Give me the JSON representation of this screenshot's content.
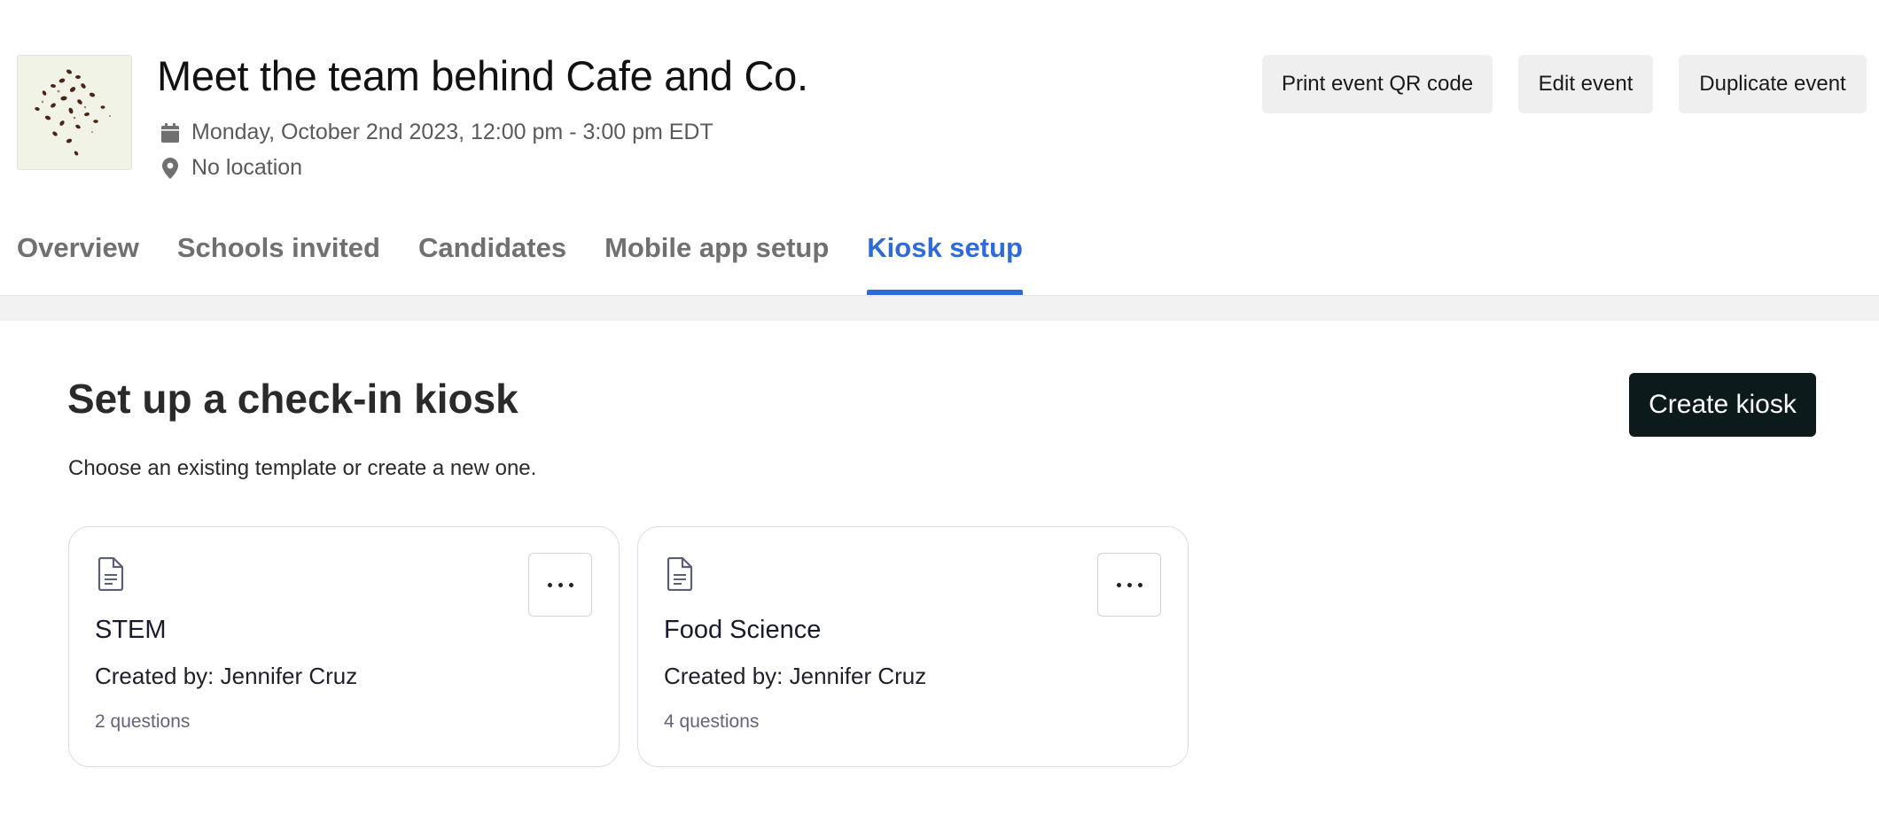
{
  "event": {
    "title": "Meet the team behind Cafe and Co.",
    "date": "Monday, October 2nd 2023, 12:00 pm - 3:00 pm EDT",
    "location": "No location",
    "date_icon": "calendar-icon",
    "location_icon": "map-pin-icon"
  },
  "header_actions": {
    "print_qr": "Print event QR code",
    "edit": "Edit event",
    "duplicate": "Duplicate event"
  },
  "tabs": [
    {
      "label": "Overview",
      "active": false
    },
    {
      "label": "Schools invited",
      "active": false
    },
    {
      "label": "Candidates",
      "active": false
    },
    {
      "label": "Mobile app setup",
      "active": false
    },
    {
      "label": "Kiosk setup",
      "active": true
    }
  ],
  "kiosk": {
    "title": "Set up a check-in kiosk",
    "subtitle": "Choose an existing template or create a new one.",
    "create_button": "Create kiosk",
    "templates": [
      {
        "name": "STEM",
        "creator": "Created by: Jennifer Cruz",
        "questions": "2 questions"
      },
      {
        "name": "Food Science",
        "creator": "Created by: Jennifer Cruz",
        "questions": "4 questions"
      }
    ]
  },
  "colors": {
    "accent": "#2f6bd8",
    "primary_button": "#0d1a1c",
    "secondary_button": "#efefef"
  }
}
